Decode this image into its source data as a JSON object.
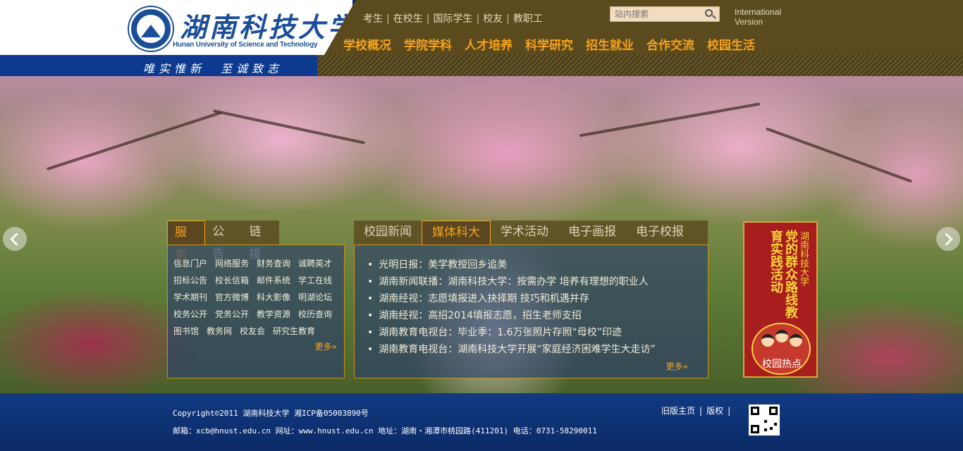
{
  "header": {
    "logo_cn": "湖南科技大学",
    "logo_en": "Hunan University of Science and Technology",
    "slogan": "唯实惟新　至诚致志",
    "top_links": [
      "考生",
      "在校生",
      "国际学生",
      "校友",
      "教职工"
    ],
    "search_placeholder": "站内搜索",
    "intl_line1": "International",
    "intl_line2": "Version",
    "main_nav": [
      "学校概况",
      "学院学科",
      "人才培养",
      "科学研究",
      "招生就业",
      "合作交流",
      "校园生活"
    ]
  },
  "services": {
    "tabs": [
      "服务",
      "公告",
      "链接"
    ],
    "links": [
      "信息门户",
      "网络服务",
      "财务查询",
      "诚聘英才",
      "招标公告",
      "校长信箱",
      "邮件系统",
      "学工在线",
      "学术期刊",
      "官方微博",
      "科大影像",
      "明湖论坛",
      "校务公开",
      "党务公开",
      "教学资源",
      "校历查询",
      "图书馆",
      "教务网",
      "校友会",
      "研究生教育"
    ],
    "more": "更多»"
  },
  "news": {
    "tabs": [
      "校园新闻",
      "媒体科大",
      "学术活动",
      "电子画报",
      "电子校报"
    ],
    "items": [
      "光明日报：美学教授回乡追美",
      "湖南新闻联播：湖南科技大学：按需办学 培养有理想的职业人",
      "湖南经视：志愿填报进入抉择期 技巧和机遇并存",
      "湖南经视：高招2014填报志愿，招生老师支招",
      "湖南教育电视台：毕业季：1.6万张照片存照“母校”印迹",
      "湖南教育电视台：湖南科技大学开展“家庭经济困难学生大走访”"
    ],
    "more": "更多»"
  },
  "feature": {
    "title": "党的群众路线教育实践活动",
    "side": "湖南科技大学",
    "label": "校园热点"
  },
  "footer": {
    "copyright": "Copyright©2011 湖南科技大学 湘ICP备05003890号",
    "contact": "邮箱：xcb@hnust.edu.cn 网址：www.hnust.edu.cn 地址：湖南・湘潭市桃园路(411201) 电话：0731-58290011",
    "links": [
      "旧版主页",
      "版权"
    ]
  }
}
